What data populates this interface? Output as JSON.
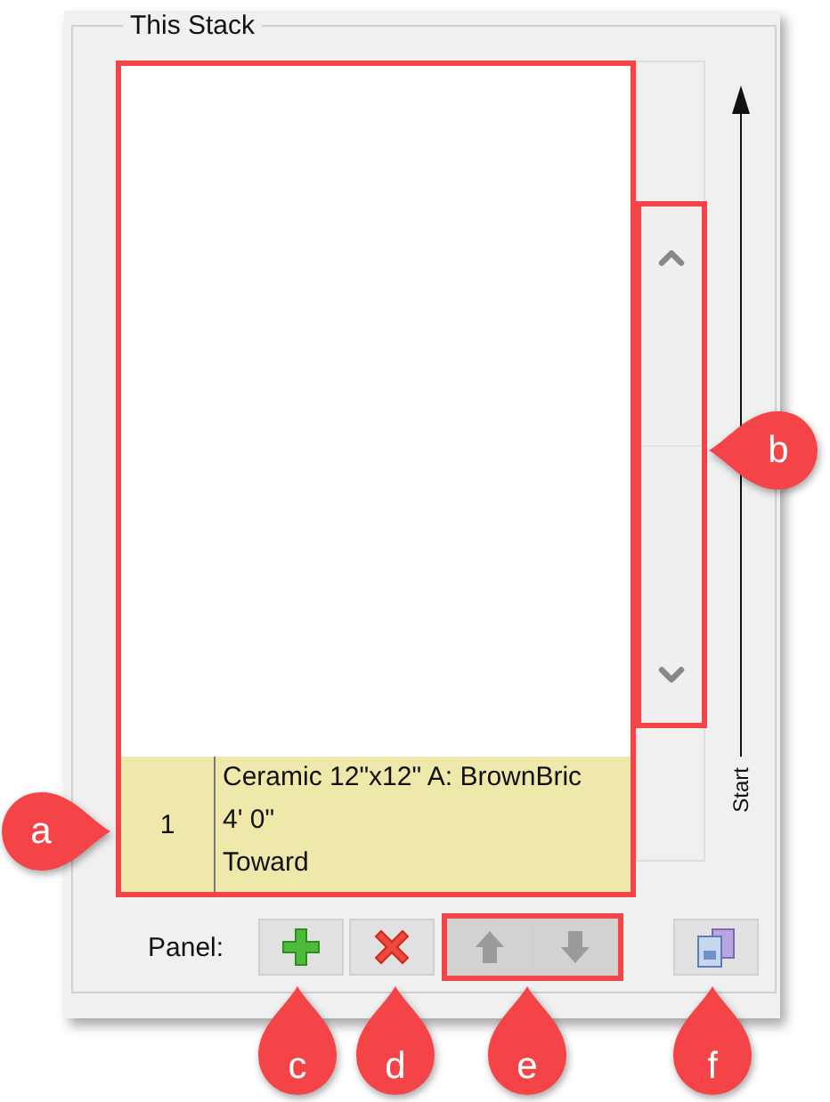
{
  "group": {
    "title": "This Stack"
  },
  "stack_rows": [
    {
      "index": "1",
      "lines": [
        "Ceramic 12\"x12\" A: BrownBric",
        "4' 0\"",
        "Toward"
      ],
      "selected": true
    }
  ],
  "direction_label": "Start",
  "panel_label": "Panel:",
  "buttons": [
    {
      "kind": "add",
      "disabled": false
    },
    {
      "kind": "delete",
      "disabled": false
    }
  ],
  "move_buttons": [
    {
      "kind": "move-up",
      "disabled": true
    },
    {
      "kind": "move-down",
      "disabled": true
    }
  ],
  "copy_button": {
    "kind": "copy",
    "disabled": false
  },
  "callouts": [
    {
      "letter": "a",
      "kind": "right"
    },
    {
      "letter": "b",
      "kind": "left"
    },
    {
      "letter": "c",
      "kind": "up"
    },
    {
      "letter": "d",
      "kind": "up"
    },
    {
      "letter": "e",
      "kind": "up"
    },
    {
      "letter": "f",
      "kind": "up"
    }
  ]
}
